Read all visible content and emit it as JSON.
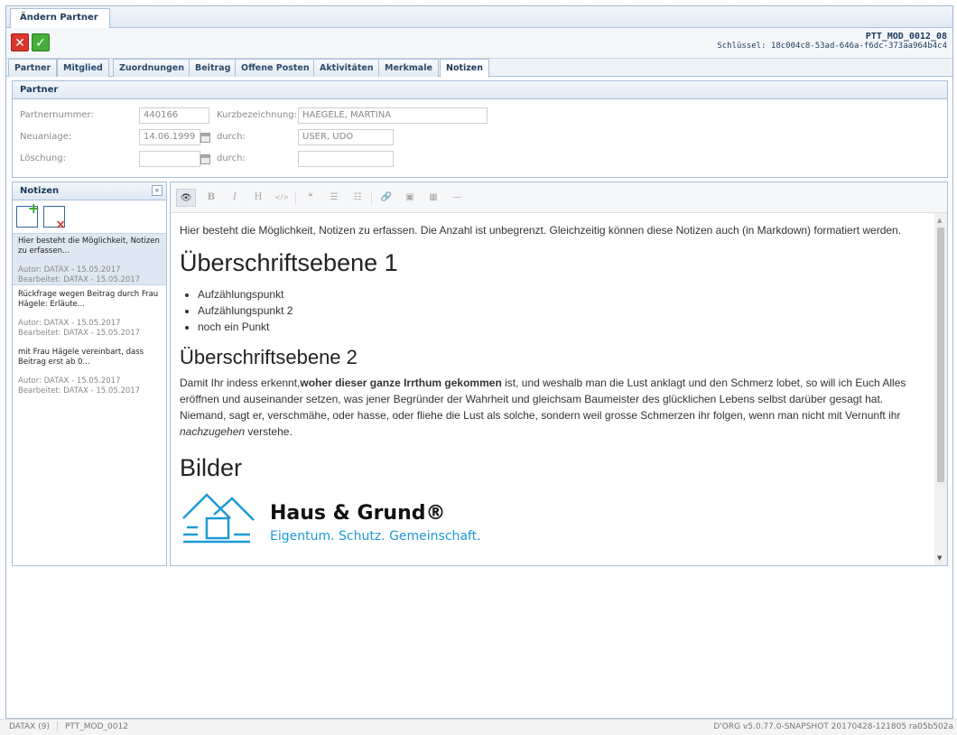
{
  "window": {
    "tab_label": "Ändern Partner"
  },
  "header": {
    "record_id": "PTT_MOD_0012_08",
    "key_line": "Schlüssel: 18c004c8-53ad-646a-f6dc-373aa964b4c4"
  },
  "toolbar": {
    "cancel_icon": "close-x",
    "save_icon": "checkmark"
  },
  "tabs": [
    {
      "label": "Partner"
    },
    {
      "label": "Mitglied"
    },
    {
      "label": "Zuordnungen"
    },
    {
      "label": "Beitrag"
    },
    {
      "label": "Offene Posten"
    },
    {
      "label": "Aktivitäten"
    },
    {
      "label": "Merkmale"
    },
    {
      "label": "Notizen",
      "active": true
    }
  ],
  "partner_panel": {
    "title": "Partner",
    "partnernummer_label": "Partnernummer:",
    "partnernummer_value": "440166",
    "kurzbezeichnung_label": "Kurzbezeichnung:",
    "kurzbezeichnung_value": "HAEGELE, MARTINA",
    "neuanlage_label": "Neuanlage:",
    "neuanlage_value": "14.06.1999",
    "durch_label": "durch:",
    "neuanlage_durch_value": "USER, UDO",
    "loeschung_label": "Löschung:",
    "loeschung_value": "",
    "loeschung_durch_value": ""
  },
  "notes_panel": {
    "title": "Notizen",
    "collapse_glyph": "«",
    "items": [
      {
        "text": "Hier besteht die Möglichkeit, Notizen zu erfassen...",
        "author": "Autor: DATAX - 15.05.2017",
        "edited": "Bearbeitet: DATAX - 15.05.2017"
      },
      {
        "text": "Rückfrage wegen Beitrag durch Frau Hägele: Erläute...",
        "author": "Autor: DATAX - 15.05.2017",
        "edited": "Bearbeitet: DATAX - 15.05.2017"
      },
      {
        "text": "mit Frau Hägele vereinbart, dass Beitrag erst ab 0...",
        "author": "Autor: DATAX - 15.05.2017",
        "edited": "Bearbeitet: DATAX - 15.05.2017"
      }
    ]
  },
  "editor": {
    "toolbar": {
      "preview": "👁",
      "bold": "B",
      "italic": "I",
      "heading": "H",
      "code": "</>",
      "quote": "❝",
      "ul": "☰",
      "ol": "☷",
      "link": "🔗",
      "image": "▣",
      "table": "▦",
      "hr": "—"
    },
    "intro": "Hier besteht die Möglichkeit, Notizen zu erfassen. Die Anzahl ist unbegrenzt. Gleichzeitig können diese Notizen auch (in Markdown) formatiert werden.",
    "h1": "Überschriftsebene 1",
    "bullets": [
      "Aufzählungspunkt",
      "Aufzählungspunkt 2",
      "noch ein Punkt"
    ],
    "h2": "Überschriftsebene 2",
    "para_before_bold": "Damit Ihr indess erkennt,",
    "para_bold": "woher dieser ganze Irrthum gekommen",
    "para_after_bold": " ist, und weshalb man die Lust anklagt und den Schmerz lobet, so will ich Euch Alles eröffnen und auseinander setzen, was jener Begründer der Wahrheit und gleichsam Baumeister des glücklichen Lebens selbst darüber gesagt hat. Niemand, sagt er, verschmähe, oder hasse, oder fliehe die Lust als solche, sondern weil grosse Schmerzen ihr folgen, wenn man nicht mit Vernunft ihr ",
    "para_italic": "nachzugehen",
    "para_end": " verstehe.",
    "h_bilder": "Bilder",
    "logo_brand": "Haus & Grund®",
    "logo_tagline": "Eigentum. Schutz. Gemeinschaft."
  },
  "status_bar": {
    "user": "DATAX (9)",
    "module": "PTT_MOD_0012",
    "version": "D'ORG v5.0.77.0-SNAPSHOT 20170428-121805 ra05b502a"
  },
  "colors": {
    "frame_border": "#9fb8d4",
    "header_text": "#1b3a5c",
    "cancel": "#d9372e",
    "save": "#45ad3a",
    "logo_blue": "#1c9ad6"
  }
}
